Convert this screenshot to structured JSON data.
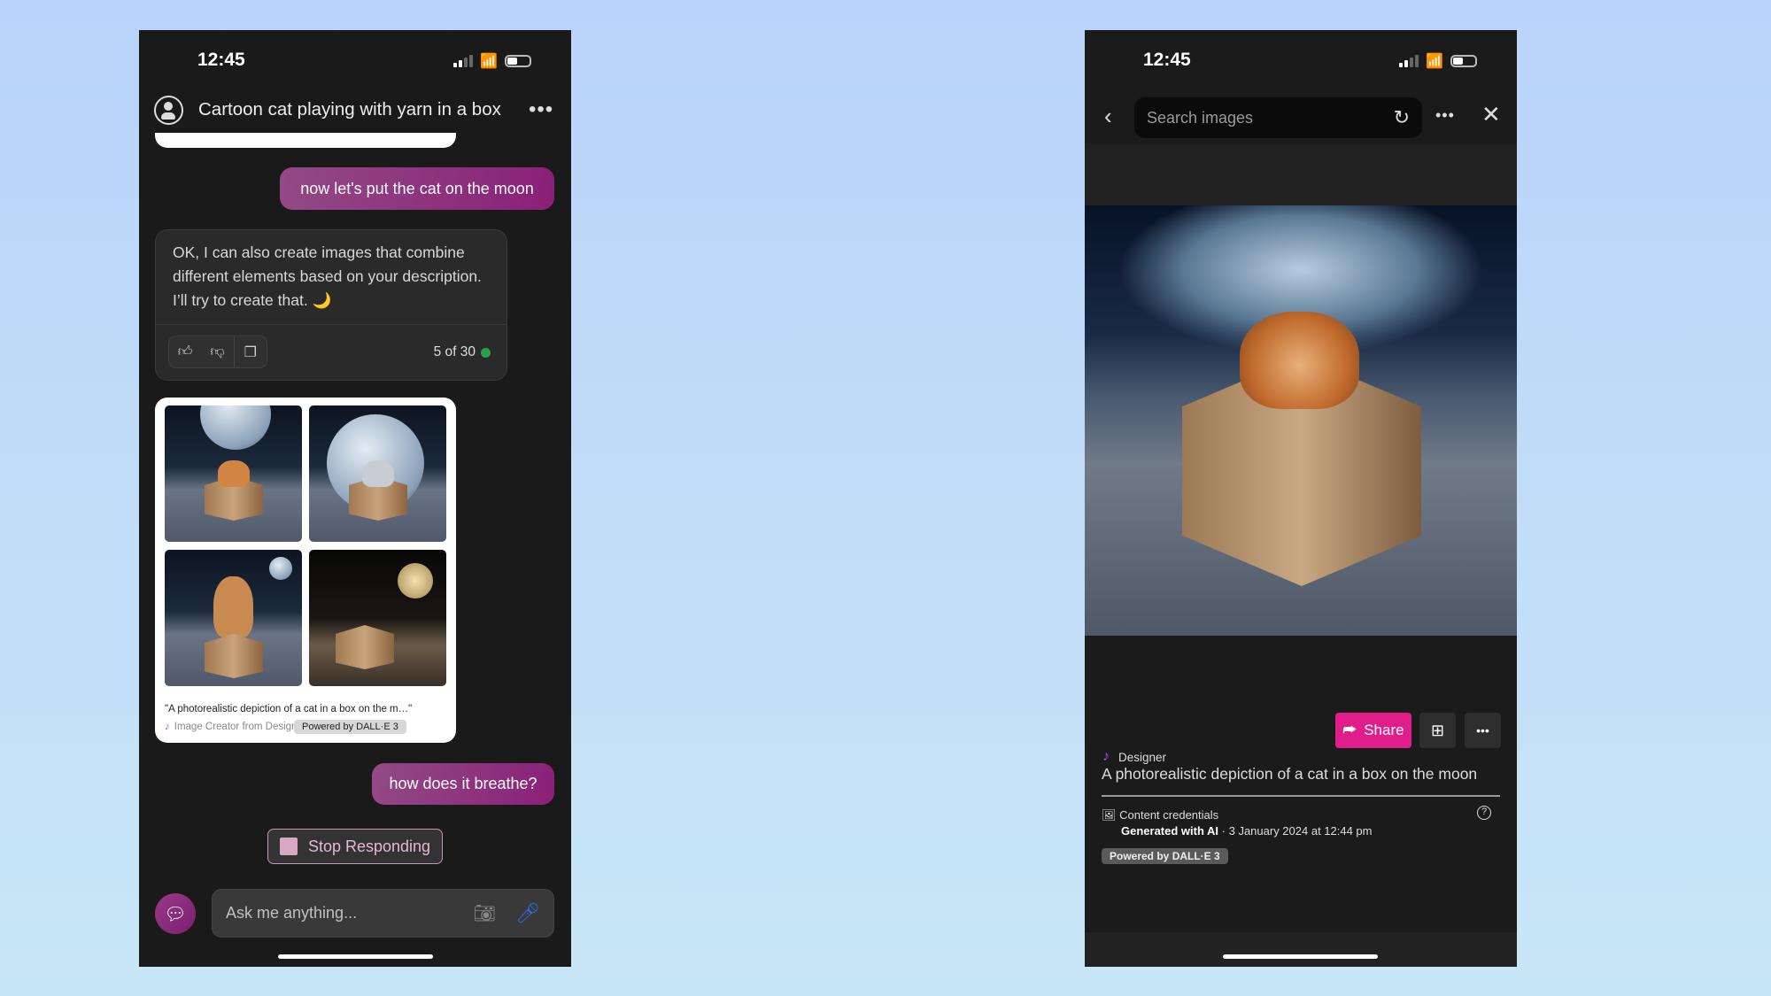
{
  "status": {
    "time": "12:45"
  },
  "left": {
    "header": {
      "title": "Cartoon cat playing with yarn in a box",
      "more": "•••"
    },
    "messages": {
      "user1": "now let's put the cat on the moon",
      "assistant": "OK, I can also create images that combine different elements based on your description. I’ll try to create that. 🌙",
      "count": "5 of 30",
      "user2": "how does it breathe?"
    },
    "image_card": {
      "caption": "\"A photorealistic depiction of a cat in a box on the m…\"",
      "credit": "Image Creator from Designer",
      "badge": "Powered by DALL·E 3"
    },
    "stop_label": "Stop Responding",
    "input": {
      "placeholder": "Ask me anything..."
    }
  },
  "right": {
    "search": {
      "placeholder": "Search images"
    },
    "designer": "Designer",
    "share_label": "Share",
    "more": "•••",
    "caption": "A photorealistic depiction of a cat in a box on the moon",
    "credentials": {
      "title": "Content credentials",
      "generated": "Generated with AI",
      "date": " · 3 January 2024 at 12:44 pm"
    },
    "badge": "Powered by DALL·E 3"
  },
  "colors": {
    "accent": "#e11d8b",
    "user_bubble": "#8a2078",
    "status_dot": "#27a14c"
  }
}
